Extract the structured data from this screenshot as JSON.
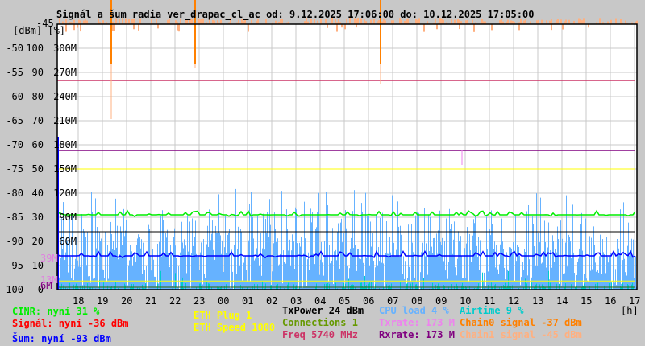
{
  "title": "Signál a šum radia ver_drapac_cl_ac od: 9.12.2025 17:06:00 do: 10.12.2025 17:05:00",
  "y_axis": {
    "units_label": "[dBm] [%]",
    "top_label": "-45",
    "rows": [
      {
        "dbm": "-50",
        "pct": "100",
        "rate": "300M"
      },
      {
        "dbm": "-55",
        "pct": "90",
        "rate": "270M"
      },
      {
        "dbm": "-60",
        "pct": "80",
        "rate": "240M"
      },
      {
        "dbm": "-65",
        "pct": "70",
        "rate": "210M"
      },
      {
        "dbm": "-70",
        "pct": "60",
        "rate": "180M"
      },
      {
        "dbm": "-75",
        "pct": "50",
        "rate": "150M"
      },
      {
        "dbm": "-80",
        "pct": "40",
        "rate": "120M"
      },
      {
        "dbm": "-85",
        "pct": "30",
        "rate": "90M"
      },
      {
        "dbm": "-90",
        "pct": "20",
        "rate": "60M"
      },
      {
        "dbm": "-95",
        "pct": "10",
        "rate": ""
      },
      {
        "dbm": "-100",
        "pct": "0",
        "rate": ""
      }
    ],
    "extra_labels": [
      {
        "text": "39M",
        "color": "#e080e0"
      },
      {
        "text": "13M",
        "color": "#e080e0"
      },
      {
        "text": "6M",
        "color": "#800080"
      }
    ]
  },
  "x_axis": {
    "ticks": [
      "18",
      "19",
      "20",
      "21",
      "22",
      "23",
      "00",
      "01",
      "02",
      "03",
      "04",
      "05",
      "06",
      "07",
      "08",
      "09",
      "10",
      "11",
      "12",
      "13",
      "14",
      "15",
      "16",
      "17"
    ],
    "unit": "[h]"
  },
  "legend": {
    "cinr": {
      "text": "CINR: nyní 31 %",
      "color": "#00ee00"
    },
    "signal": {
      "text": "Signál: nyní -36 dBm",
      "color": "#ff0000"
    },
    "noise": {
      "text": "Šum: nyní -93 dBm",
      "color": "#0000ff"
    },
    "eth_plug": {
      "text": "ETH Plug 1",
      "color": "#ffff00"
    },
    "eth_speed": {
      "text": "ETH Speed 1000",
      "color": "#ffff00"
    },
    "txpower": {
      "text": "TxPower 24 dBm",
      "color": "#000000"
    },
    "connections": {
      "text": "Connections 1",
      "color": "#669900"
    },
    "freq": {
      "text": "Freq 5740 MHz",
      "color": "#cc3366"
    },
    "cpu": {
      "text": "CPU load 4 %",
      "color": "#66b2ff"
    },
    "txrate": {
      "text": "Txrate: 173 M",
      "color": "#ee82ee"
    },
    "rxrate": {
      "text": "Rxrate: 173 M",
      "color": "#800080"
    },
    "airtime": {
      "text": "Airtime 9 %",
      "color": "#00cccc"
    },
    "chain0": {
      "text": "Chain0 signal -37 dBm",
      "color": "#ff8000"
    },
    "chain1": {
      "text": "Chain1 signal -45 dBm",
      "color": "#ffb080"
    }
  },
  "chart_data": {
    "type": "line",
    "title": "Signál a šum radia ver_drapac_cl_ac od: 9.12.2025 17:06:00 do: 10.12.2025 17:05:00",
    "xlabel": "[h]",
    "ylabel": "[dBm] [%]",
    "ylim_dbm": [
      -100,
      -45
    ],
    "x_range_hours": [
      17.1,
      41.1
    ],
    "grid": true,
    "series": [
      {
        "name": "Freq",
        "level_dbm": -56.7,
        "color": "#cc3366"
      },
      {
        "name": "Rxrate",
        "level_dbm": -71.2,
        "color": "#800080"
      },
      {
        "name": "ETH Speed",
        "level_dbm": -75,
        "color": "#ffff00"
      },
      {
        "name": "CINR",
        "level_dbm": -84.5,
        "color": "#00ee00",
        "noise": 1
      },
      {
        "name": "TxPower",
        "level_dbm": -88,
        "color": "#000000"
      },
      {
        "name": "Šum",
        "level_dbm": -93,
        "color": "#0000ff",
        "noise": 1
      },
      {
        "name": "ETH Plug",
        "level_dbm": -98.2,
        "color": "#ffff00"
      },
      {
        "name": "Connections",
        "level_dbm": -99.5,
        "color": "#336600"
      },
      {
        "name": "CPU load",
        "range_dbm": [
          -100,
          -79
        ],
        "color": "#66b2ff"
      },
      {
        "name": "Airtime",
        "range_dbm": [
          -100,
          -96
        ],
        "color": "#00cccc"
      },
      {
        "name": "Chain0 signal",
        "level_dbm": -37,
        "color": "#ff8000"
      },
      {
        "name": "Chain1 signal",
        "level_dbm": -45,
        "color": "#ffb080"
      }
    ]
  }
}
